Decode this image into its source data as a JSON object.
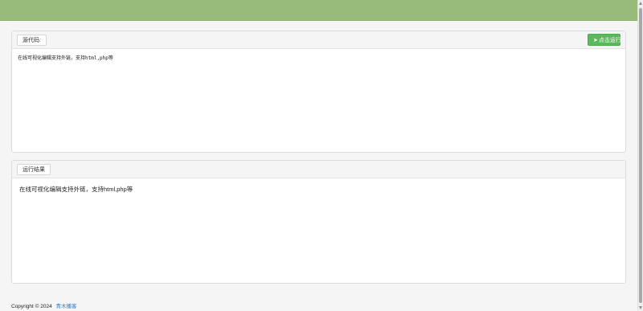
{
  "header": {
    "color": "#98bb7b"
  },
  "editor_panel": {
    "label": "源代码:",
    "run_button_label": "点击运行",
    "run_button_icon": "send-icon",
    "code": "在线可视化编辑支持外链，支持html,php等"
  },
  "result_panel": {
    "label": "运行结果",
    "output": "在线可视化编辑支持外链，支持html,php等"
  },
  "footer": {
    "copyright": "Copyright © 2024",
    "link_text": "青木播客"
  },
  "colors": {
    "accent_green": "#5cb85c",
    "link_blue": "#2d7ed8"
  }
}
